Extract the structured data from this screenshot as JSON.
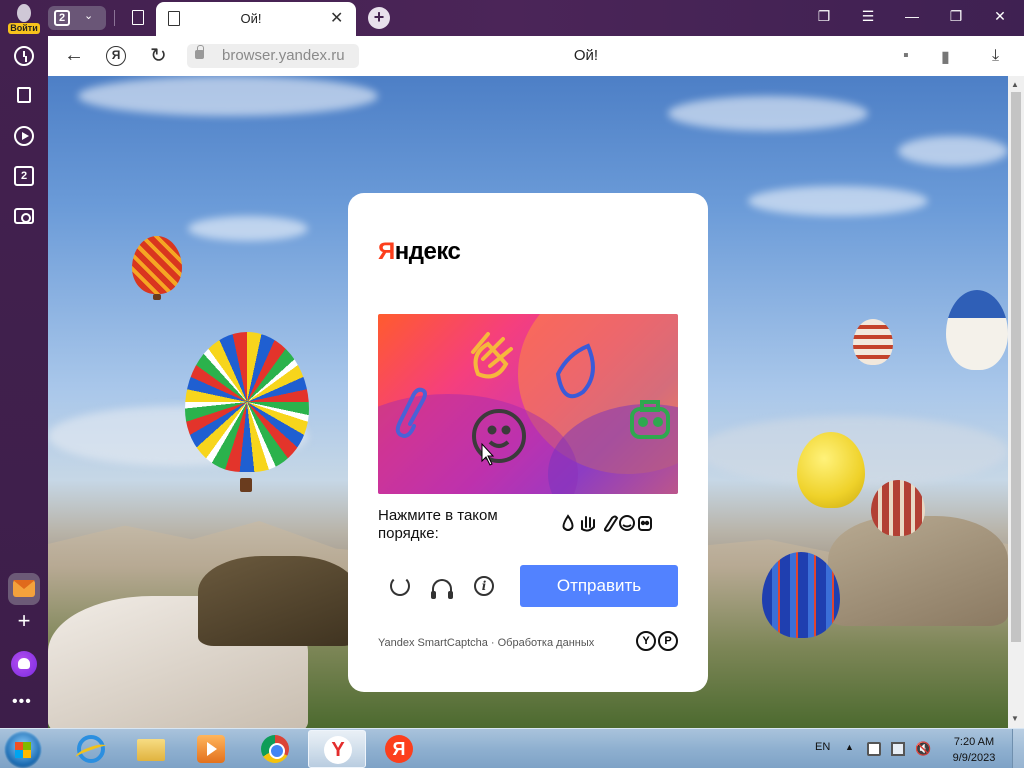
{
  "browser": {
    "profile": {
      "login_label": "Войти"
    },
    "tab_count": "2",
    "tabs": [
      {
        "title": "Ой!"
      }
    ],
    "address": {
      "url": "browser.yandex.ru",
      "page_title": "Ой!",
      "ya_button": "Я"
    }
  },
  "sidebar": {
    "items": [
      {
        "icon": "history-icon"
      },
      {
        "icon": "collections-icon"
      },
      {
        "icon": "video-icon"
      },
      {
        "icon": "tabs-icon",
        "label": "2"
      },
      {
        "icon": "screenshot-icon"
      }
    ],
    "bottom": [
      {
        "icon": "mail-icon"
      },
      {
        "icon": "add-icon"
      },
      {
        "icon": "alice-icon"
      },
      {
        "icon": "more-icon",
        "label": "•••"
      }
    ]
  },
  "captcha": {
    "logo_first": "Я",
    "logo_rest": "ндекс",
    "instruction": "Нажмите в таком порядке:",
    "order_icons": [
      "drop-icon",
      "hand-icon",
      "paperclip-icon",
      "smiley-icon",
      "robot-icon"
    ],
    "submit_label": "Отправить",
    "footer_text": "Yandex SmartCaptcha · Обработка данных",
    "footer_logos": [
      "Y",
      "P"
    ],
    "colors": {
      "submit": "#5282ff",
      "logo_accent": "#fc3f1d"
    }
  },
  "taskbar": {
    "language": "EN",
    "time": "7:20 AM",
    "date": "9/9/2023",
    "pinned": [
      {
        "name": "internet-explorer-icon"
      },
      {
        "name": "file-explorer-icon"
      },
      {
        "name": "media-player-icon"
      },
      {
        "name": "chrome-icon"
      },
      {
        "name": "yandex-browser-icon",
        "active": true,
        "glyph": "Y"
      },
      {
        "name": "yandex-icon",
        "glyph": "Я"
      }
    ]
  }
}
